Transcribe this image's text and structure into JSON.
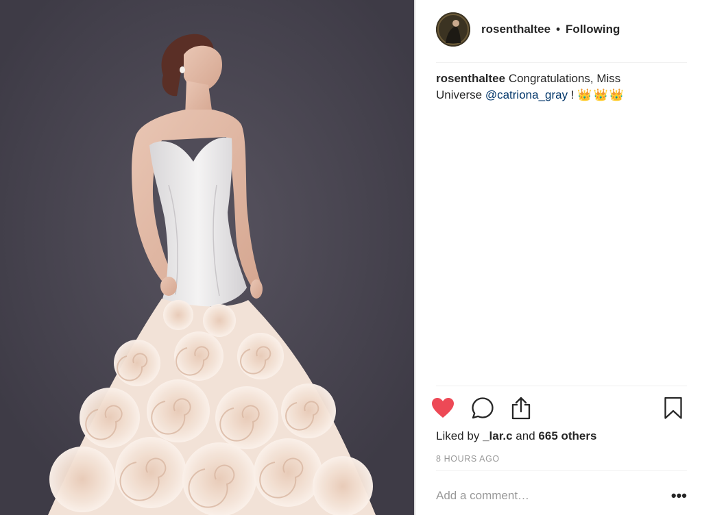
{
  "post": {
    "image_alt": "Model in a white strapless mermaid gown with ruffled rose skirt"
  },
  "header": {
    "username": "rosenthaltee",
    "separator": "•",
    "follow_label": "Following",
    "avatar_icon": "profile-photo"
  },
  "caption": {
    "username": "rosenthaltee",
    "text": "Congratulations, Miss Universe",
    "mention": "@catriona_gray",
    "suffix": " !",
    "emojis": "👑👑👑"
  },
  "actions": {
    "like_icon": "heart-filled-icon",
    "comment_icon": "speech-bubble-icon",
    "share_icon": "share-upload-icon",
    "save_icon": "bookmark-icon",
    "like_color": "#ed4956"
  },
  "likes": {
    "prefix": "Liked by",
    "user": "_lar.c",
    "joiner": "and",
    "others": "665 others"
  },
  "timestamp": "8 HOURS AGO",
  "comment": {
    "placeholder": "Add a comment…",
    "more_label": "•••"
  }
}
